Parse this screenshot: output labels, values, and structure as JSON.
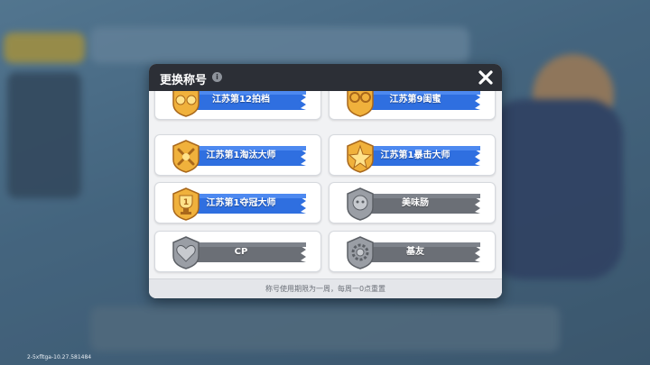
{
  "dialog": {
    "title": "更换称号",
    "footer_note": "称号使用期限为一周，每周一0点重置"
  },
  "titles": [
    {
      "label": "江苏第12拍档",
      "tier": "gold",
      "icon": "duo-badge-icon"
    },
    {
      "label": "江苏第9闺蜜",
      "tier": "gold",
      "icon": "bestie-badge-icon"
    },
    {
      "label": "江苏第1淘汰大师",
      "tier": "gold",
      "icon": "knockout-badge-icon"
    },
    {
      "label": "江苏第1暴击大师",
      "tier": "gold",
      "icon": "crit-badge-icon"
    },
    {
      "label": "江苏第1夺冠大师",
      "tier": "gold",
      "icon": "trophy-badge-icon"
    },
    {
      "label": "美味肠",
      "tier": "gray",
      "icon": "sausage-badge-icon"
    },
    {
      "label": "CP",
      "tier": "gray",
      "icon": "heart-badge-icon"
    },
    {
      "label": "基友",
      "tier": "gray",
      "icon": "gear-badge-icon"
    }
  ],
  "version": "2-5xfltga-10.27.581484",
  "colors": {
    "header": "#2c2f36",
    "gold_ribbon": "#2f6fe0",
    "gray_ribbon": "#6b6f76",
    "gold_badge": "#f0b13c",
    "gray_badge": "#9a9ea5"
  }
}
